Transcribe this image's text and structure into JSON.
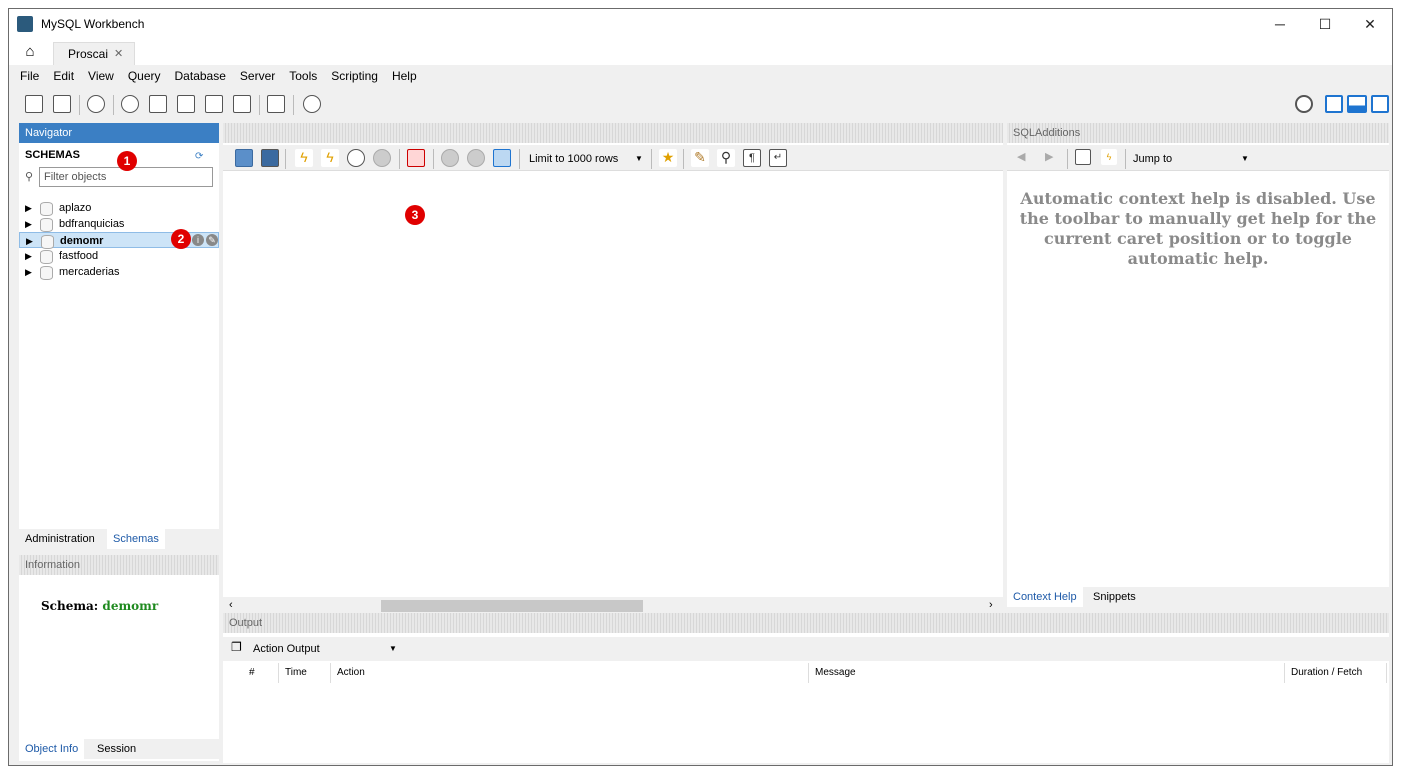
{
  "window": {
    "title": "MySQL Workbench"
  },
  "tabs": {
    "connection_tab": "Proscai",
    "close_glyph": "✕"
  },
  "menu": [
    "File",
    "Edit",
    "View",
    "Query",
    "Database",
    "Server",
    "Tools",
    "Scripting",
    "Help"
  ],
  "navigator": {
    "header": "Navigator",
    "schemas_label": "SCHEMAS",
    "filter_placeholder": "Filter objects",
    "schemas": [
      "aplazo",
      "bdfranquicias",
      "demomr",
      "fastfood",
      "mercaderias"
    ],
    "selected_schema": "demomr",
    "tabs": [
      "Administration",
      "Schemas"
    ],
    "active_tab": "Schemas"
  },
  "information": {
    "header": "Information",
    "schema_label": "Schema:",
    "schema_value": "demomr",
    "tabs": [
      "Object Info",
      "Session"
    ]
  },
  "editor": {
    "limit_label": "Limit to 1000 rows"
  },
  "sql_additions": {
    "header": "SQLAdditions",
    "jump_to": "Jump to",
    "help_text": "Automatic context help is disabled. Use the toolbar to manually get help for the current caret position or to toggle automatic help.",
    "tabs": [
      "Context Help",
      "Snippets"
    ]
  },
  "output": {
    "header": "Output",
    "selector": "Action Output",
    "columns": [
      "#",
      "Time",
      "Action",
      "Message",
      "Duration / Fetch"
    ]
  },
  "annotations": [
    "1",
    "2",
    "3"
  ],
  "colors": {
    "accent": "#3b7fc4",
    "badge": "#e00000",
    "schema_value": "#1f8a1f"
  }
}
